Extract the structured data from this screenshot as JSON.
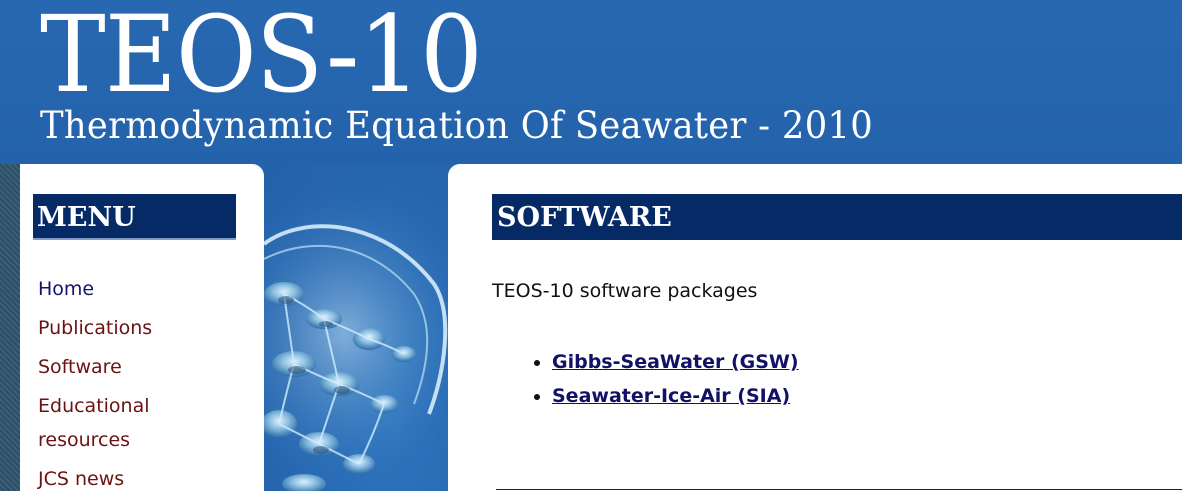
{
  "header": {
    "title": "TEOS-10",
    "subtitle": "Thermodynamic Equation Of Seawater - 2010"
  },
  "sidebar": {
    "menu_title": "MENU",
    "items": [
      {
        "label": "Home"
      },
      {
        "label": "Publications"
      },
      {
        "label": "Software"
      },
      {
        "label": "Educational resources"
      },
      {
        "label": "JCS news"
      }
    ]
  },
  "main": {
    "section_title": "SOFTWARE",
    "intro": "TEOS-10 software packages",
    "packages": [
      {
        "label": "Gibbs-SeaWater (GSW)"
      },
      {
        "label": "Seawater-Ice-Air (SIA)"
      }
    ]
  },
  "colors": {
    "header_blue": "#2764ab",
    "section_header_navy": "#062a66",
    "menu_link": "#6b1212",
    "home_link": "#14146b",
    "package_link": "#111166"
  }
}
